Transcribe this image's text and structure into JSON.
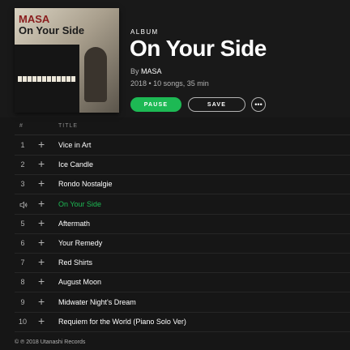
{
  "cover": {
    "line1": "MASA",
    "line2": "On Your Side"
  },
  "album": {
    "label": "ALBUM",
    "title": "On Your Side",
    "by_prefix": "By",
    "artist": "MASA",
    "meta": "2018 • 10 songs, 35 min"
  },
  "buttons": {
    "pause": "PAUSE",
    "save": "SAVE",
    "more": "•••"
  },
  "list_header": {
    "number": "#",
    "title": "TITLE"
  },
  "tracks": [
    {
      "num": "1",
      "title": "Vice in Art"
    },
    {
      "num": "2",
      "title": "Ice Candle"
    },
    {
      "num": "3",
      "title": "Rondo Nostalgie"
    },
    {
      "num": "",
      "title": "On Your Side",
      "playing": true
    },
    {
      "num": "5",
      "title": "Aftermath"
    },
    {
      "num": "6",
      "title": "Your Remedy"
    },
    {
      "num": "7",
      "title": "Red Shirts"
    },
    {
      "num": "8",
      "title": "August Moon"
    },
    {
      "num": "9",
      "title": "Midwater Night's Dream"
    },
    {
      "num": "10",
      "title": "Requiem for the World (Piano Solo Ver)"
    }
  ],
  "plus_glyph": "+",
  "footer": "© ℗ 2018 Utanashi Records",
  "colors": {
    "accent": "#1db954",
    "background": "#161616",
    "muted": "#b3b3b3"
  }
}
